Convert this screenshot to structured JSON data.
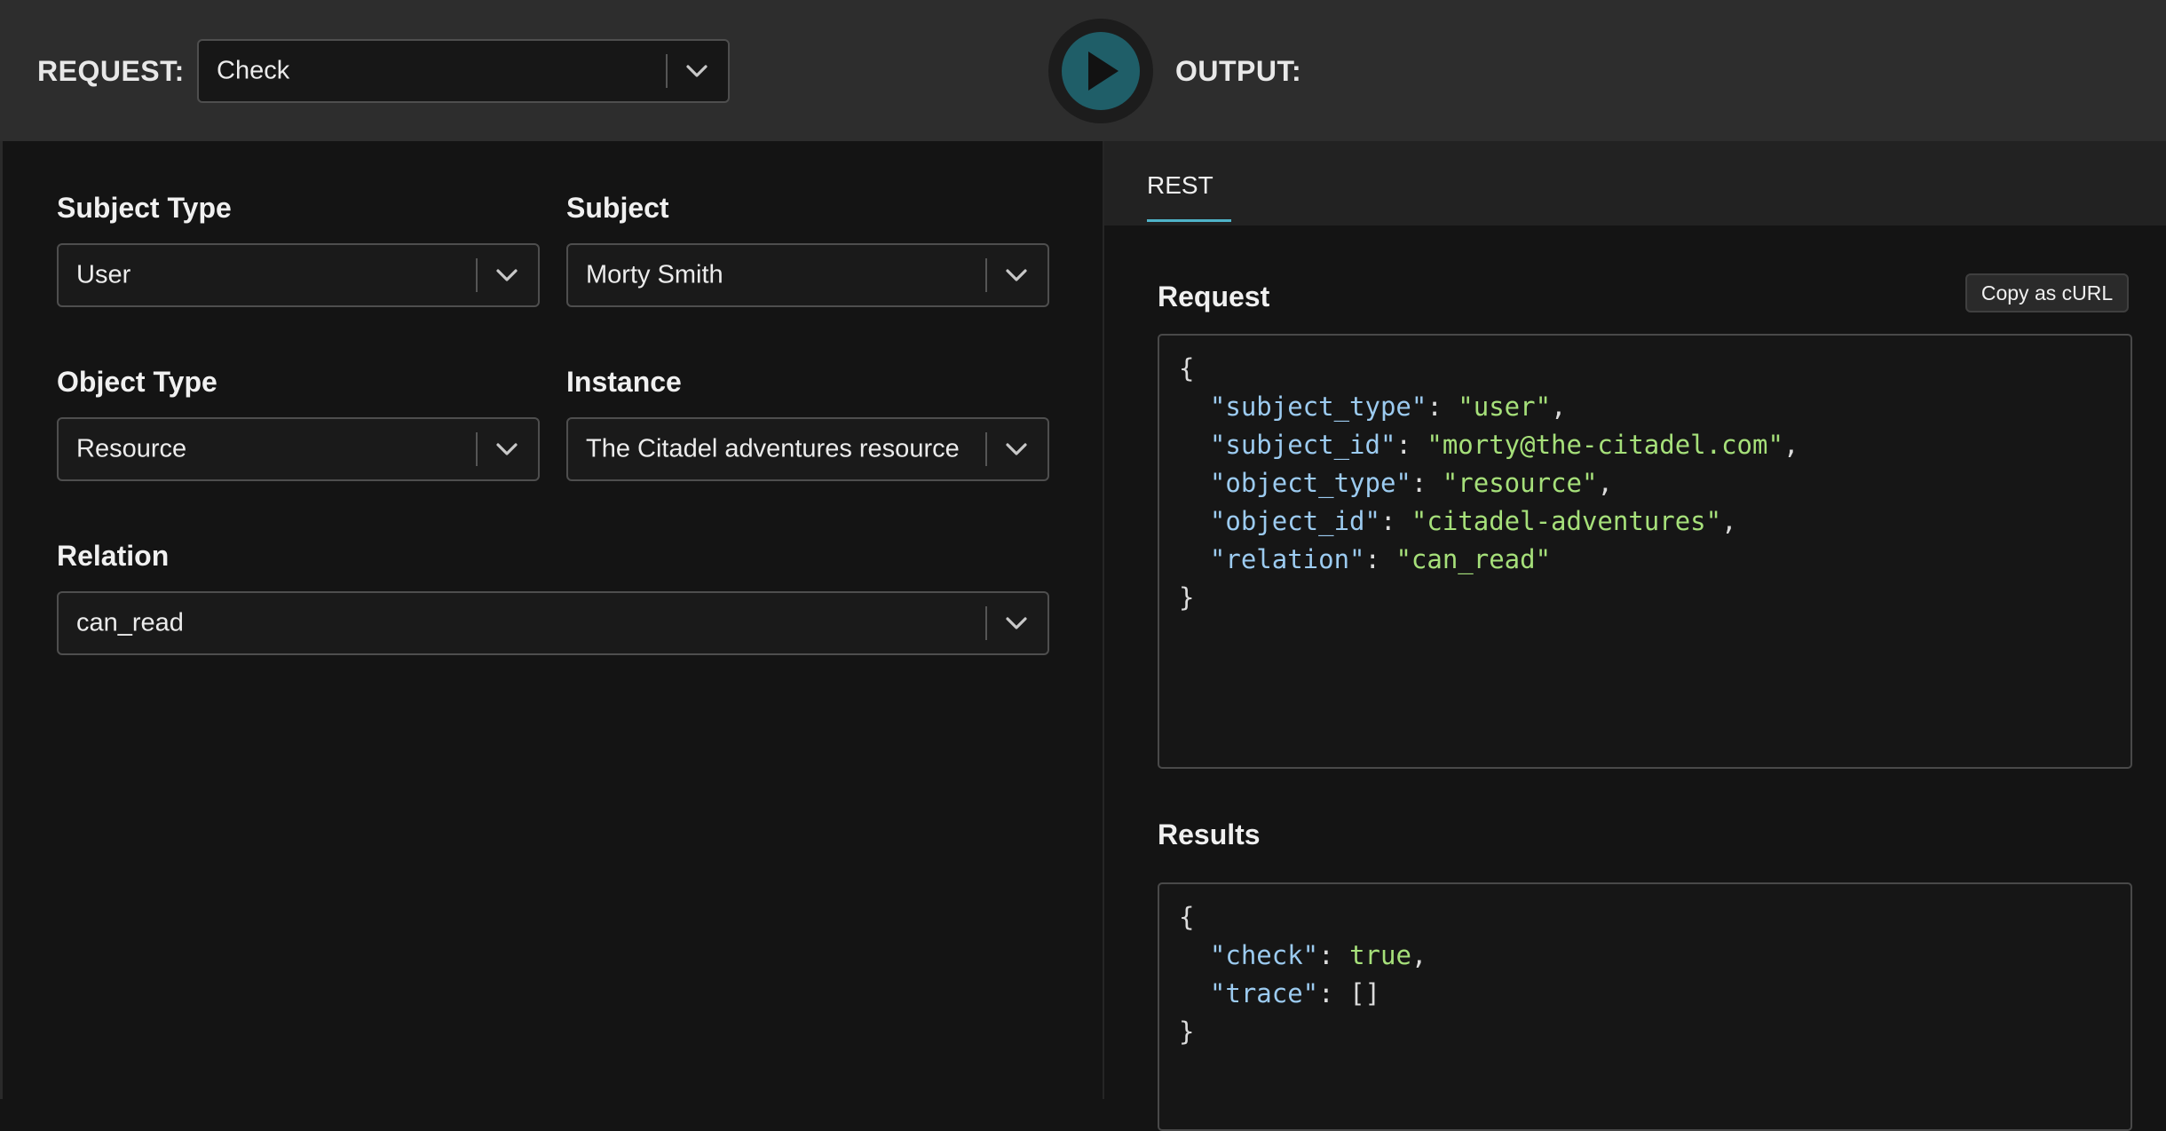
{
  "topbar": {
    "request_label": "REQUEST:",
    "request_select_value": "Check",
    "output_label": "OUTPUT:",
    "run_icon": "play-icon"
  },
  "form": {
    "subject_type": {
      "label": "Subject Type",
      "value": "User"
    },
    "subject": {
      "label": "Subject",
      "value": "Morty Smith"
    },
    "object_type": {
      "label": "Object Type",
      "value": "Resource"
    },
    "instance": {
      "label": "Instance",
      "value": "The Citadel adventures resource"
    },
    "relation": {
      "label": "Relation",
      "value": "can_read"
    }
  },
  "output": {
    "tabs": [
      {
        "label": "REST",
        "active": true
      }
    ],
    "request": {
      "title": "Request",
      "copy_button": "Copy as cURL",
      "open_brace": "{",
      "close_brace": "}",
      "fields": [
        {
          "key": "\"subject_type\"",
          "value": "\"user\""
        },
        {
          "key": "\"subject_id\"",
          "value": "\"morty@the-citadel.com\""
        },
        {
          "key": "\"object_type\"",
          "value": "\"resource\""
        },
        {
          "key": "\"object_id\"",
          "value": "\"citadel-adventures\""
        },
        {
          "key": "\"relation\"",
          "value": "\"can_read\""
        }
      ]
    },
    "results": {
      "title": "Results",
      "open_brace": "{",
      "close_brace": "}",
      "fields": [
        {
          "key": "\"check\"",
          "value": "true"
        },
        {
          "key": "\"trace\"",
          "value": "[]"
        }
      ]
    }
  },
  "colors": {
    "topbar_bg": "#2d2d2d",
    "panel_bg": "#141414",
    "accent": "#4fb3c9",
    "run_button": "#1f5e68",
    "json_key": "#9ccbf0",
    "json_string": "#a6e07a"
  }
}
